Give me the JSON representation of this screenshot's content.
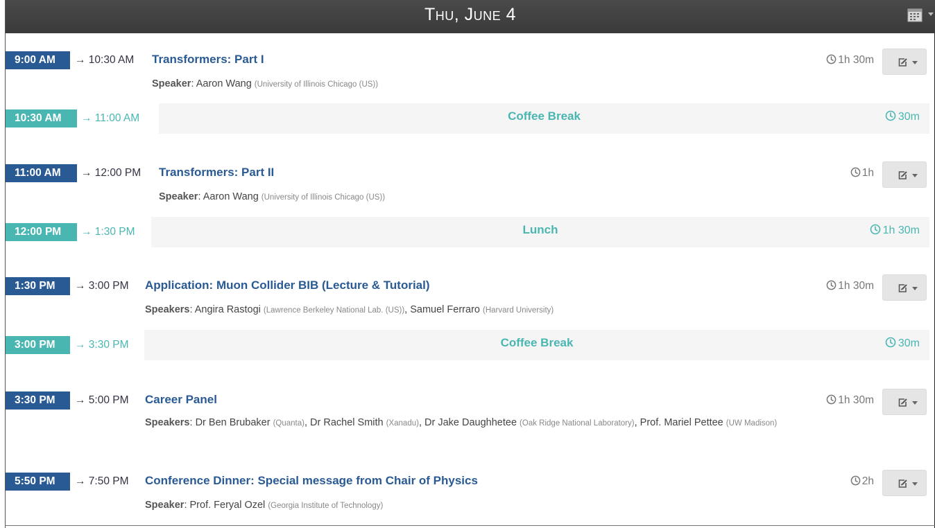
{
  "day": {
    "title": "Thu, June 4"
  },
  "entries": [
    {
      "kind": "talk",
      "start": "9:00 AM",
      "end": "→ 10:30 AM",
      "title": "Transformers: Part I",
      "speakers_label": "Speaker",
      "speakers": [
        {
          "name": "Aaron Wang",
          "aff": "(University of Illinois Chicago (US))"
        }
      ],
      "duration": "1h 30m"
    },
    {
      "kind": "break",
      "start": "10:30 AM",
      "end": "→ 11:00 AM",
      "title": "Coffee Break",
      "duration": "30m"
    },
    {
      "kind": "talk",
      "start": "11:00 AM",
      "end": "→ 12:00 PM",
      "title": "Transformers: Part II",
      "speakers_label": "Speaker",
      "speakers": [
        {
          "name": "Aaron Wang",
          "aff": "(University of Illinois Chicago (US))"
        }
      ],
      "duration": "1h"
    },
    {
      "kind": "break",
      "start": "12:00 PM",
      "end": "→ 1:30 PM",
      "title": "Lunch",
      "duration": "1h 30m"
    },
    {
      "kind": "talk",
      "start": "1:30 PM",
      "end": "→ 3:00 PM",
      "title": "Application: Muon Collider BIB (Lecture & Tutorial)",
      "speakers_label": "Speakers",
      "speakers": [
        {
          "name": "Angira Rastogi",
          "aff": "(Lawrence Berkeley National Lab. (US))"
        },
        {
          "name": "Samuel Ferraro",
          "aff": "(Harvard University)"
        }
      ],
      "duration": "1h 30m"
    },
    {
      "kind": "break",
      "start": "3:00 PM",
      "end": "→ 3:30 PM",
      "title": "Coffee Break",
      "duration": "30m"
    },
    {
      "kind": "talk",
      "start": "3:30 PM",
      "end": "→ 5:00 PM",
      "title": "Career Panel",
      "speakers_label": "Speakers",
      "speakers": [
        {
          "name": "Dr Ben Brubaker",
          "aff": "(Quanta)"
        },
        {
          "name": "Dr Rachel Smith",
          "aff": "(Xanadu)"
        },
        {
          "name": "Dr Jake Daughhetee",
          "aff": "(Oak Ridge National Laboratory)"
        },
        {
          "name": "Prof. Mariel Pettee",
          "aff": "(UW Madison)"
        }
      ],
      "duration": "1h 30m"
    },
    {
      "kind": "talk",
      "start": "5:50 PM",
      "end": "→ 7:50 PM",
      "title": "Conference Dinner: Special message from Chair of Physics",
      "speakers_label": "Speaker",
      "speakers": [
        {
          "name": "Prof. Feryal Ozel",
          "aff": "(Georgia Institute of Technology)"
        }
      ],
      "duration": "2h"
    }
  ],
  "colors": {
    "talk": "#2a5a94",
    "break": "#49b6b2",
    "header": "#3d3d3d"
  },
  "icons": {
    "calendar": "calendar-icon",
    "clock": "clock-icon",
    "edit": "edit-icon",
    "caret": "caret-down-icon"
  }
}
